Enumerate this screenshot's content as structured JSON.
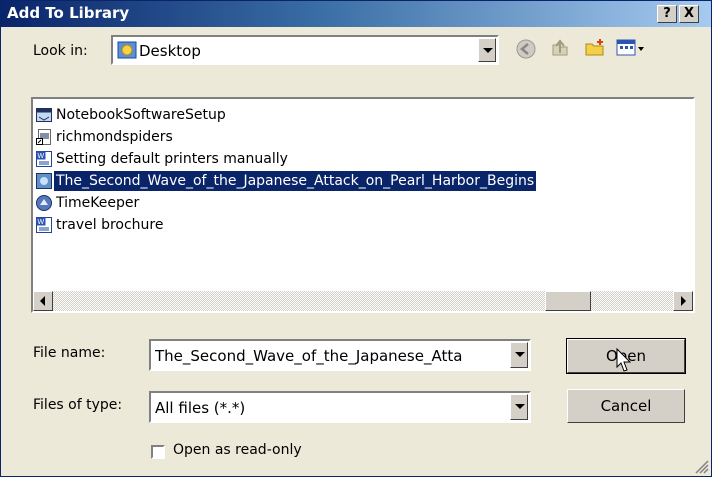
{
  "window": {
    "title": "Add To Library",
    "help_label": "?",
    "close_label": "X"
  },
  "lookin": {
    "label": "Look in:",
    "value": "Desktop"
  },
  "files": [
    {
      "name": "NotebookSoftwareSetup",
      "icon": "installer-icon"
    },
    {
      "name": "richmondspiders",
      "icon": "shortcut-icon"
    },
    {
      "name": "Setting default printers manually",
      "icon": "word-doc-icon"
    },
    {
      "name": "The_Second_Wave_of_the_Japanese_Attack_on_Pearl_Harbor_Begins",
      "icon": "media-file-icon",
      "selected": true
    },
    {
      "name": "TimeKeeper",
      "icon": "app-icon"
    },
    {
      "name": "travel brochure",
      "icon": "word-doc-icon"
    }
  ],
  "filename": {
    "label": "File name:",
    "value": "The_Second_Wave_of_the_Japanese_Atta"
  },
  "filetype": {
    "label": "Files of type:",
    "value": "All files (*.*)"
  },
  "buttons": {
    "open": "Open",
    "cancel": "Cancel"
  },
  "readonly_label": "Open as read-only",
  "colors": {
    "title_start": "#0a246a",
    "title_end": "#a6caf0",
    "face": "#ece9d8",
    "selection": "#0a246a"
  }
}
